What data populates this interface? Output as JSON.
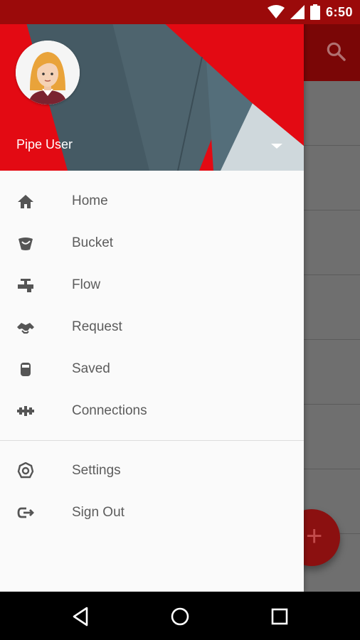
{
  "status": {
    "time": "6:50"
  },
  "drawer": {
    "user": {
      "name": "Pipe User"
    },
    "items": [
      {
        "label": "Home",
        "icon": "home-icon"
      },
      {
        "label": "Bucket",
        "icon": "bucket-icon"
      },
      {
        "label": "Flow",
        "icon": "faucet-icon"
      },
      {
        "label": "Request",
        "icon": "handshake-icon"
      },
      {
        "label": "Saved",
        "icon": "jar-icon"
      },
      {
        "label": "Connections",
        "icon": "pipe-connector-icon"
      }
    ],
    "secondary": [
      {
        "label": "Settings",
        "icon": "gear-icon"
      },
      {
        "label": "Sign Out",
        "icon": "sign-out-icon"
      }
    ]
  },
  "fab": {
    "label": "+"
  },
  "colors": {
    "header_red": "#e30a13",
    "status_bar": "#9b0a0a",
    "slate": "#455a64",
    "icon_gray": "#5c5c5c"
  }
}
